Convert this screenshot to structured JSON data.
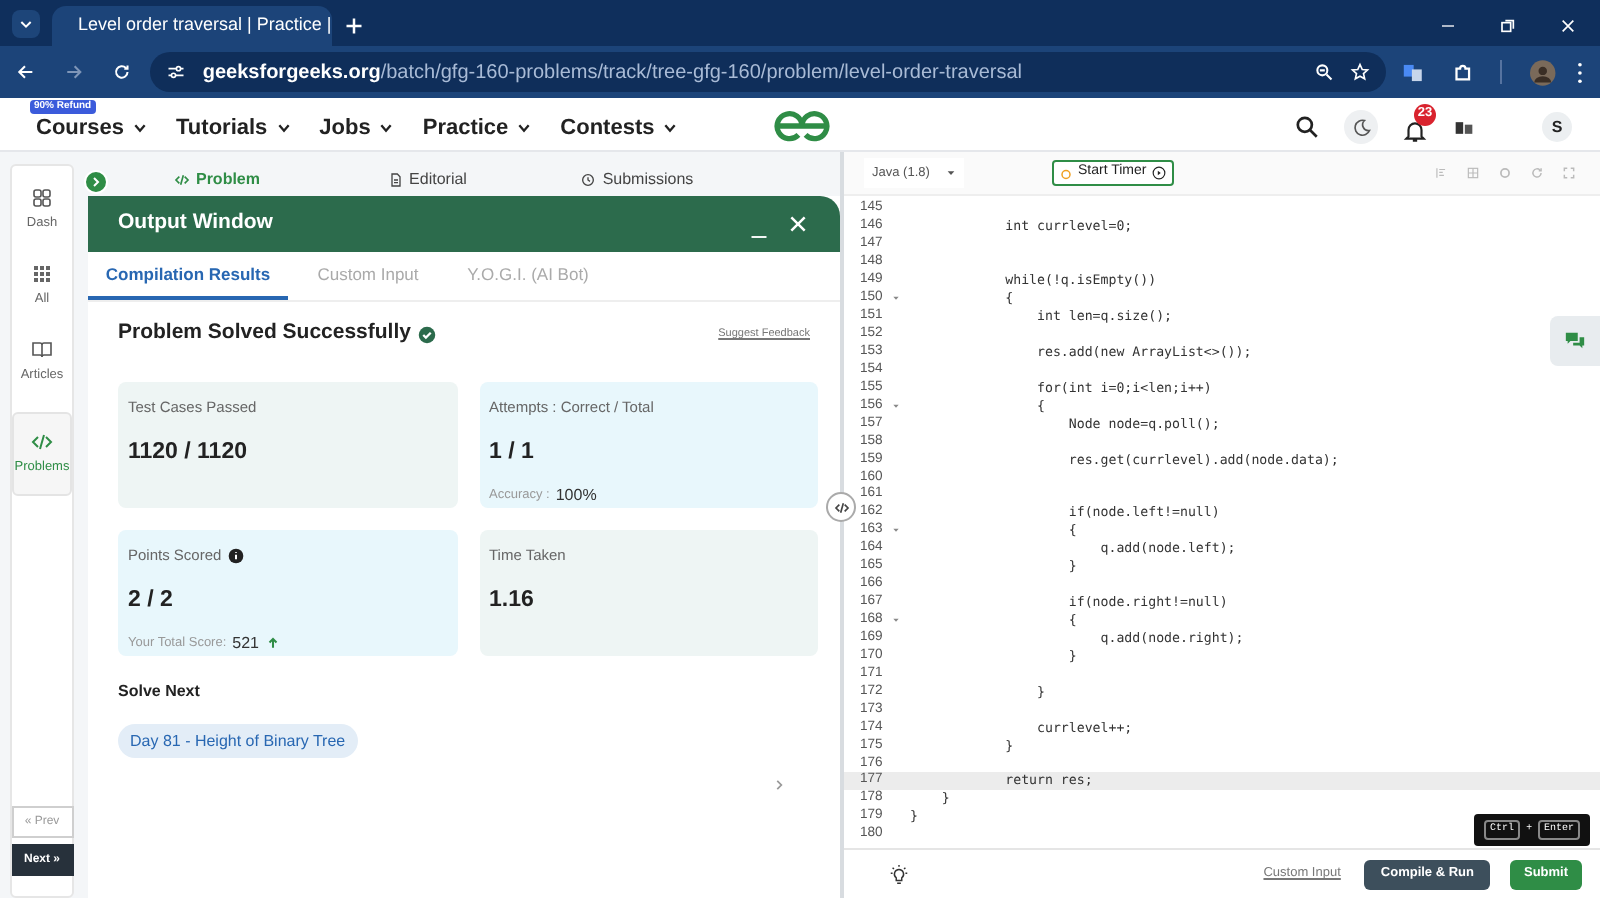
{
  "browser": {
    "tab_title": "Level order traversal | Practice |",
    "url_domain": "geeksforgeeks.org",
    "url_path": "/batch/gfg-160-problems/track/tree-gfg-160/problem/level-order-traversal"
  },
  "site_nav": {
    "badge": "90% Refund",
    "items": [
      "Courses",
      "Tutorials",
      "Jobs",
      "Practice",
      "Contests"
    ],
    "notification_count": "23",
    "avatar_initial": "S"
  },
  "sidebar": {
    "items": [
      {
        "label": "Dash",
        "kind": "dash",
        "selected": false
      },
      {
        "label": "All",
        "kind": "all",
        "selected": false
      },
      {
        "label": "Articles",
        "kind": "articles",
        "selected": false
      },
      {
        "label": "Problems",
        "kind": "problems",
        "selected": true
      }
    ],
    "prev": "« Prev",
    "next": "Next »"
  },
  "problem_tabs": [
    {
      "label": "Problem",
      "kind": "code",
      "selected": true
    },
    {
      "label": "Editorial",
      "kind": "doc",
      "selected": false
    },
    {
      "label": "Submissions",
      "kind": "clock",
      "selected": false
    }
  ],
  "output_window": {
    "title": "Output Window",
    "tabs": [
      {
        "label": "Compilation Results",
        "selected": true
      },
      {
        "label": "Custom Input",
        "selected": false
      },
      {
        "label": "Y.O.G.I. (AI Bot)",
        "selected": false
      }
    ],
    "status": "Problem Solved Successfully",
    "feedback_link": "Suggest Feedback",
    "cards": [
      {
        "label": "Test Cases Passed",
        "value": "1120 / 1120",
        "color": "#eef5f4"
      },
      {
        "label": "Attempts : Correct / Total",
        "value": "1 / 1",
        "note": "Accuracy :",
        "note_value": "100%",
        "color": "#e8f7fc"
      },
      {
        "label": "Points Scored",
        "value": "2 / 2",
        "note": "Your Total Score:",
        "note_value": "521",
        "info": true,
        "trend_up": true,
        "color": "#e8f7fc"
      },
      {
        "label": "Time Taken",
        "value": "1.16",
        "color": "#eef5f4"
      }
    ],
    "solve_next": {
      "title": "Solve Next",
      "items": [
        "Day 81 - Height of Binary Tree"
      ]
    }
  },
  "editor": {
    "language": "Java (1.8)",
    "timer": "Start Timer",
    "lines": [
      {
        "n": "145"
      },
      {
        "n": "146",
        "code": "            int currlevel=0;"
      },
      {
        "n": "147"
      },
      {
        "n": "148"
      },
      {
        "n": "149",
        "code": "            while(!q.isEmpty())"
      },
      {
        "n": "150",
        "code": "            {",
        "fold": true
      },
      {
        "n": "151",
        "code": "                int len=q.size();"
      },
      {
        "n": "152"
      },
      {
        "n": "153",
        "code": "                res.add(new ArrayList<>());"
      },
      {
        "n": "154"
      },
      {
        "n": "155",
        "code": "                for(int i=0;i<len;i++)"
      },
      {
        "n": "156",
        "code": "                {",
        "fold": true
      },
      {
        "n": "157",
        "code": "                    Node node=q.poll();"
      },
      {
        "n": "158"
      },
      {
        "n": "159",
        "code": "                    res.get(currlevel).add(node.data);"
      },
      {
        "n": "160"
      },
      {
        "n": "161"
      },
      {
        "n": "162",
        "code": "                    if(node.left!=null)"
      },
      {
        "n": "163",
        "code": "                    {",
        "fold": true
      },
      {
        "n": "164",
        "code": "                        q.add(node.left);"
      },
      {
        "n": "165",
        "code": "                    }"
      },
      {
        "n": "166"
      },
      {
        "n": "167",
        "code": "                    if(node.right!=null)"
      },
      {
        "n": "168",
        "code": "                    {",
        "fold": true
      },
      {
        "n": "169",
        "code": "                        q.add(node.right);"
      },
      {
        "n": "170",
        "code": "                    }"
      },
      {
        "n": "171"
      },
      {
        "n": "172",
        "code": "                }"
      },
      {
        "n": "173"
      },
      {
        "n": "174",
        "code": "                currlevel++;"
      },
      {
        "n": "175",
        "code": "            }"
      },
      {
        "n": "176"
      },
      {
        "n": "177",
        "code": "            return res;",
        "current": true
      },
      {
        "n": "178",
        "code": "    }"
      },
      {
        "n": "179",
        "code": "}"
      },
      {
        "n": "180"
      }
    ],
    "custom_input": "Custom Input",
    "compile": "Compile & Run",
    "submit": "Submit",
    "tooltip": {
      "keys": [
        "Ctrl",
        "Enter"
      ],
      "joiner": "+"
    }
  }
}
